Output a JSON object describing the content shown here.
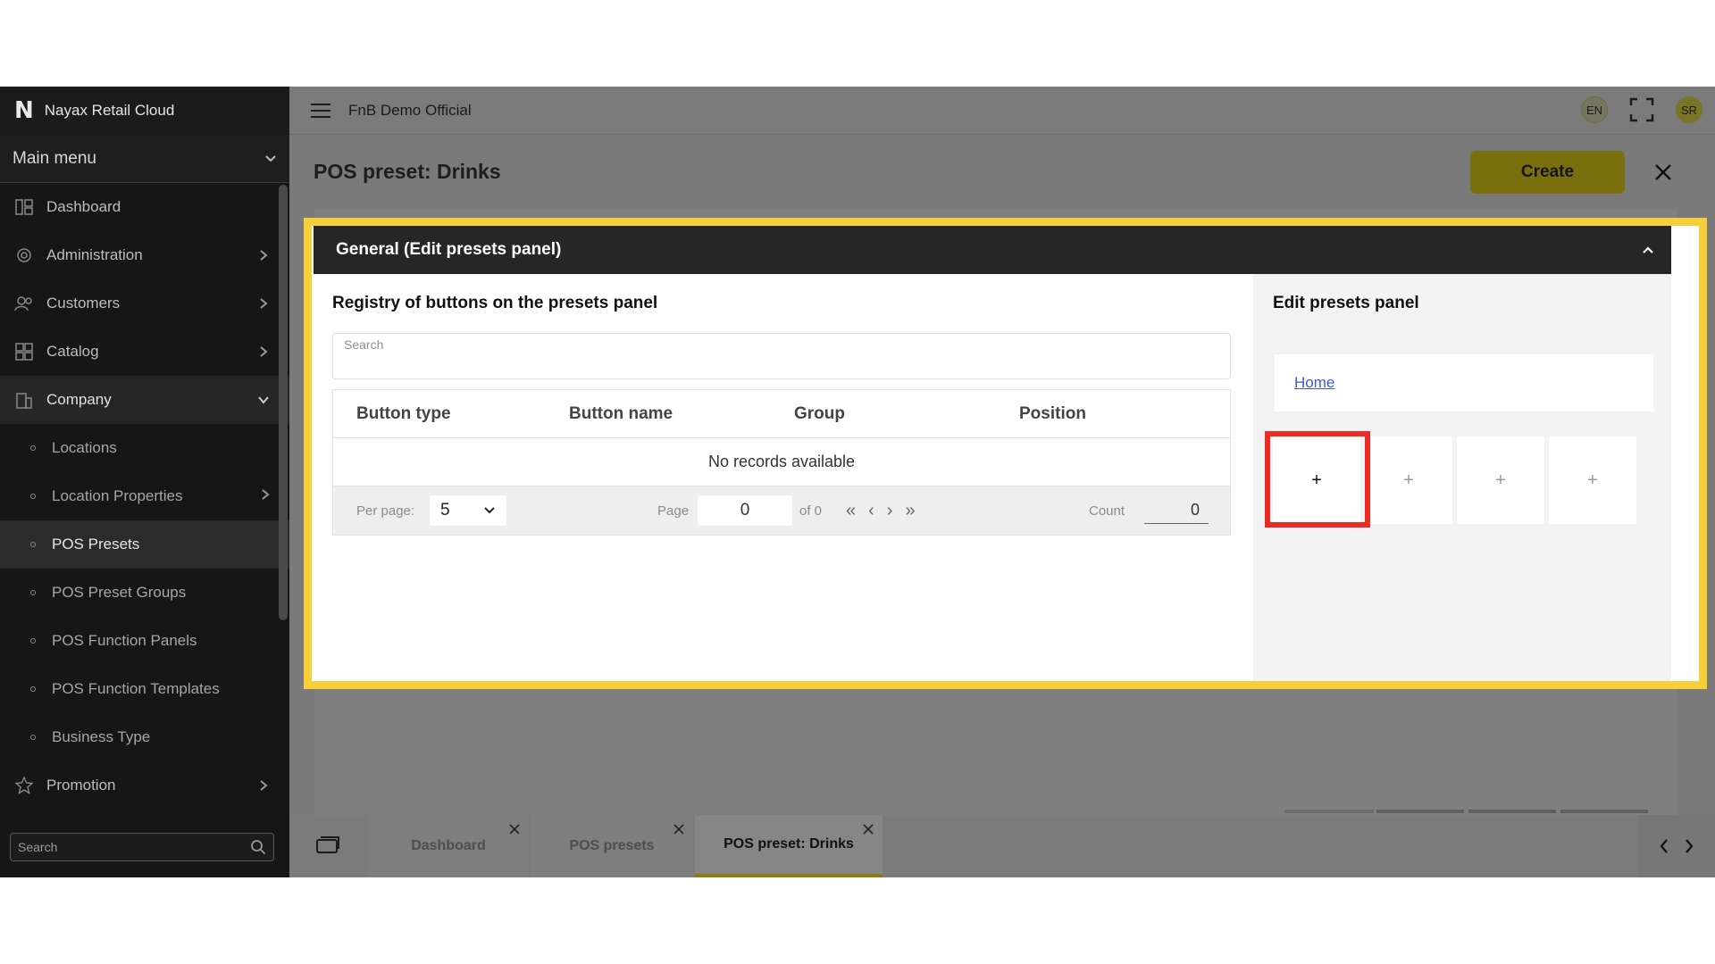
{
  "app": {
    "brand_logo": "N",
    "brand_name": "Nayax Retail Cloud"
  },
  "sidebar": {
    "main_menu_label": "Main menu",
    "items": [
      {
        "label": "Dashboard",
        "icon": "dashboard-icon",
        "has_arrow": false
      },
      {
        "label": "Administration",
        "icon": "administration-icon",
        "has_arrow": true
      },
      {
        "label": "Customers",
        "icon": "customers-icon",
        "has_arrow": true
      },
      {
        "label": "Catalog",
        "icon": "catalog-icon",
        "has_arrow": true
      },
      {
        "label": "Company",
        "icon": "company-icon",
        "has_arrow": true,
        "expanded": true
      }
    ],
    "company_subitems": [
      {
        "label": "Locations"
      },
      {
        "label": "Location Properties",
        "has_arrow": true
      },
      {
        "label": "POS Presets",
        "active": true
      },
      {
        "label": "POS Preset Groups"
      },
      {
        "label": "POS Function Panels"
      },
      {
        "label": "POS Function Templates"
      },
      {
        "label": "Business Type"
      }
    ],
    "promotion": {
      "label": "Promotion",
      "icon": "star-icon"
    },
    "search_placeholder": "Search"
  },
  "header": {
    "org_name": "FnB Demo Official",
    "lang": "EN",
    "user_initials": "SR"
  },
  "page": {
    "title": "POS preset: Drinks",
    "create_label": "Create"
  },
  "panel": {
    "title": "General (Edit presets panel)",
    "registry_title": "Registry of buttons on the presets panel",
    "search_placeholder": "Search",
    "columns": [
      "Button type",
      "Button name",
      "Group",
      "Position"
    ],
    "empty_text": "No records available",
    "pager": {
      "per_page_label": "Per page:",
      "per_page_value": "5",
      "page_label": "Page",
      "page_value": "0",
      "of_label": "of 0",
      "count_label": "Count",
      "count_value": "0"
    },
    "edit_title": "Edit presets panel",
    "home_link": "Home",
    "preset_buttons": [
      "+",
      "+",
      "+",
      "+"
    ]
  },
  "tabs": [
    {
      "label": "Dashboard",
      "active": false
    },
    {
      "label": "POS presets",
      "active": false
    },
    {
      "label": "POS preset: Drinks",
      "active": true
    }
  ],
  "colors": {
    "highlight": "#f7cf3a",
    "red_marker": "#ee2a24",
    "accent": "#7a6f0d"
  }
}
